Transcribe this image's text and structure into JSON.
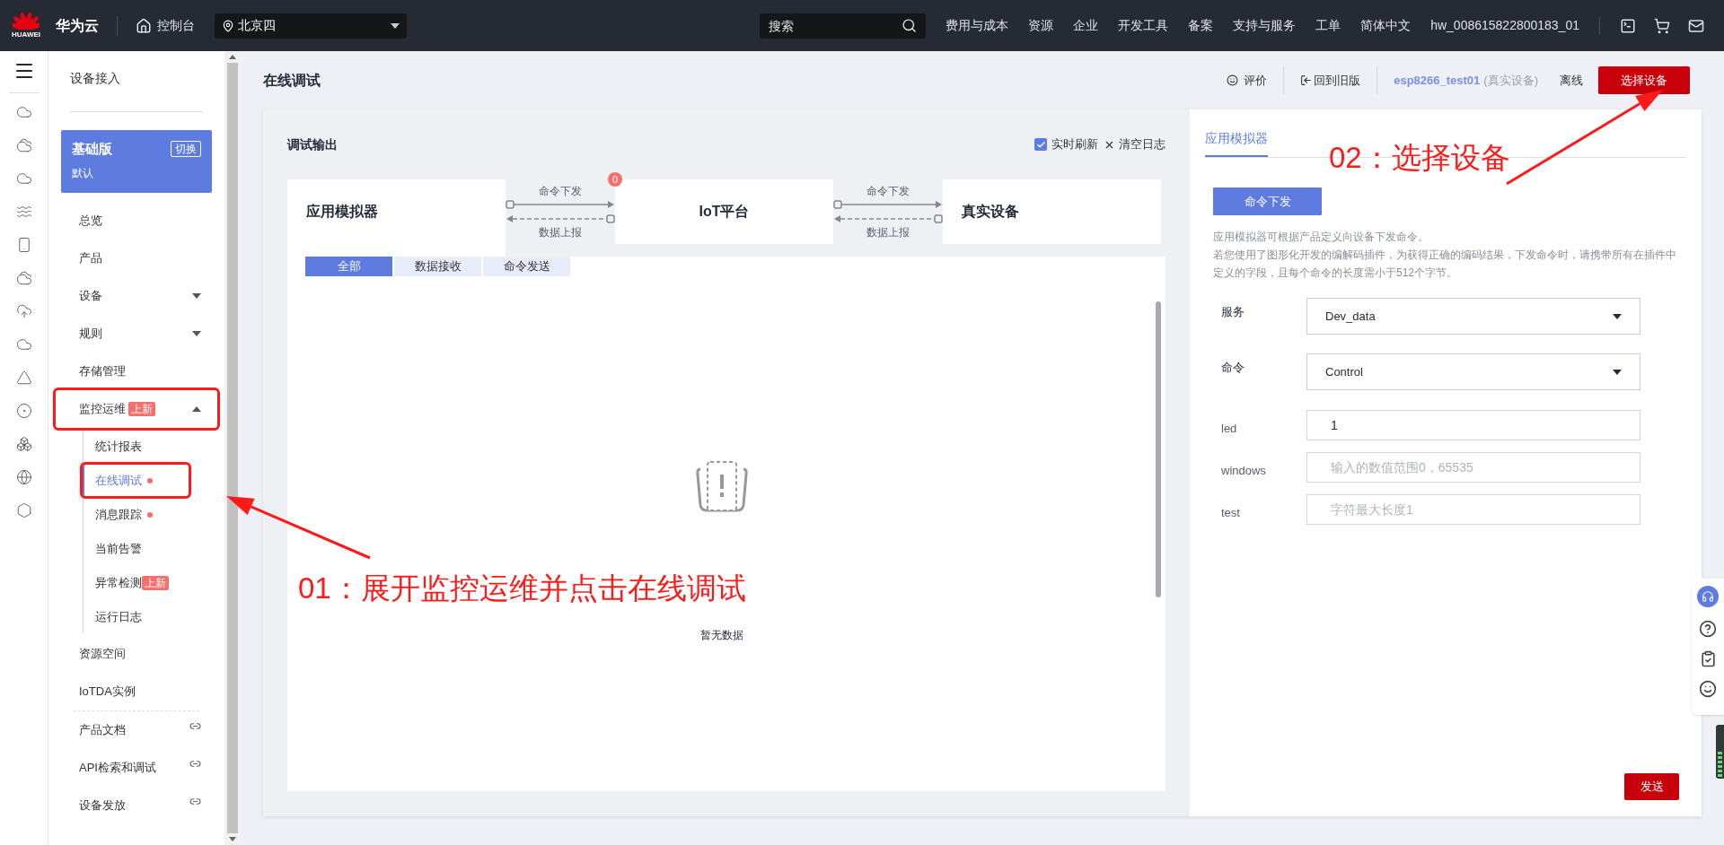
{
  "topbar": {
    "logo_text": "HUAWEI",
    "brand": "华为云",
    "console": "控制台",
    "region": "北京四",
    "search": {
      "placeholder": "搜索"
    },
    "menu": [
      "费用与成本",
      "资源",
      "企业",
      "开发工具",
      "备案",
      "支持与服务",
      "工单",
      "简体中文"
    ],
    "user": "hw_008615822800183_01"
  },
  "nav": {
    "title": "设备接入",
    "edition": {
      "name": "基础版",
      "switch": "切换",
      "note": "默认"
    },
    "items": [
      {
        "kind": "item",
        "label": "总览",
        "selected": false,
        "highlighted": false
      },
      {
        "kind": "item",
        "label": "产品",
        "selected": false,
        "highlighted": false
      },
      {
        "kind": "group",
        "label": "设备",
        "expanded": false,
        "selected": false,
        "highlighted": false
      },
      {
        "kind": "group",
        "label": "规则",
        "expanded": false,
        "selected": false,
        "highlighted": false
      },
      {
        "kind": "item",
        "label": "存储管理",
        "selected": false,
        "highlighted": false
      },
      {
        "kind": "group",
        "label": "监控运维",
        "badge": "上新",
        "expanded": true,
        "selected": false,
        "highlighted": true,
        "children": [
          {
            "label": "统计报表",
            "selected": false,
            "dot": false,
            "highlighted": false
          },
          {
            "label": "在线调试",
            "selected": true,
            "dot": true,
            "highlighted": true
          },
          {
            "label": "消息跟踪",
            "selected": false,
            "dot": true,
            "highlighted": false
          },
          {
            "label": "当前告警",
            "selected": false,
            "dot": false,
            "highlighted": false
          },
          {
            "label": "异常检测",
            "badge": "上新",
            "selected": false,
            "dot": false,
            "highlighted": false
          },
          {
            "label": "运行日志",
            "selected": false,
            "dot": false,
            "highlighted": false
          }
        ]
      },
      {
        "kind": "item",
        "label": "资源空间",
        "selected": false,
        "highlighted": false
      },
      {
        "kind": "item",
        "label": "IoTDA实例",
        "selected": false,
        "highlighted": false
      },
      {
        "kind": "link",
        "label": "产品文档",
        "selected": false,
        "highlighted": false
      },
      {
        "kind": "link",
        "label": "API检索和调试",
        "selected": false,
        "highlighted": false
      },
      {
        "kind": "link",
        "label": "设备发放",
        "selected": false,
        "highlighted": false
      }
    ]
  },
  "page": {
    "title": "在线调试",
    "rate": "评价",
    "old_version": "回到旧版",
    "device": "esp8266_test01",
    "device_type": "(真实设备)",
    "status": "离线",
    "select_button": "选择设备"
  },
  "debug": {
    "title": "调试输出",
    "realtime": {
      "label": "实时刷新",
      "checked": true
    },
    "clear": "清空日志",
    "nodes": [
      {
        "label": "应用模拟器"
      },
      {
        "label": "IoT平台",
        "badge": "0"
      },
      {
        "label": "真实设备"
      }
    ],
    "links": [
      {
        "down": "命令下发",
        "up": "数据上报"
      },
      {
        "down": "命令下发",
        "up": "数据上报"
      }
    ],
    "filters": [
      {
        "label": "全部",
        "selected": true
      },
      {
        "label": "数据接收",
        "selected": false
      },
      {
        "label": "命令发送",
        "selected": false
      }
    ],
    "empty": "暂无数据"
  },
  "simulator": {
    "tab": {
      "label": "应用模拟器",
      "selected": true
    },
    "mode_button": "命令下发",
    "description": [
      "应用模拟器可根据产品定义向设备下发命令。",
      "若您使用了图形化开发的编解码插件，为获得正确的编码结果，下发命令时，请携带所有在插件中定义的字段，且每个命令的长度需小于512个字节。"
    ],
    "fields": [
      {
        "kind": "select",
        "label": "服务",
        "value": "Dev_data"
      },
      {
        "kind": "select",
        "label": "命令",
        "value": "Control"
      },
      {
        "kind": "input",
        "label": "led",
        "value": "1"
      },
      {
        "kind": "input",
        "label": "windows",
        "placeholder": "输入的数值范围0，65535"
      },
      {
        "kind": "input",
        "label": "test",
        "placeholder": "字符最大长度1"
      }
    ],
    "send": "发送"
  },
  "annotations": [
    {
      "text": "01：展开监控运维并点击在线调试"
    },
    {
      "text": "02：选择设备"
    }
  ]
}
